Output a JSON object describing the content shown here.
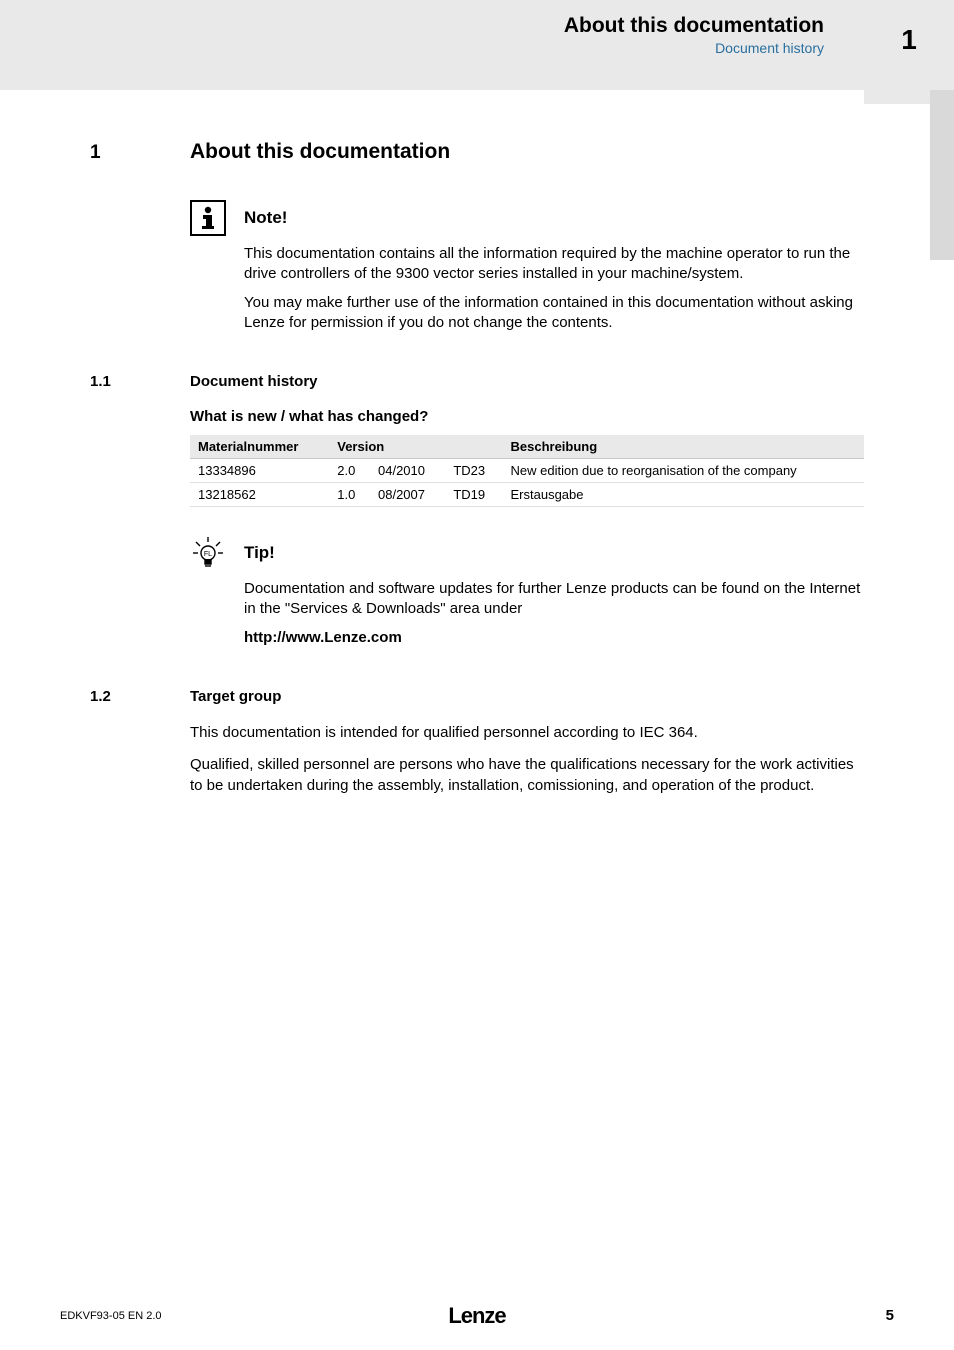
{
  "header": {
    "title": "About this documentation",
    "subtitle": "Document history",
    "chapter_number": "1"
  },
  "section": {
    "number": "1",
    "title": "About this documentation"
  },
  "note": {
    "label": "Note!",
    "para1": "This documentation contains all the information required by the machine operator to run the drive controllers of the 9300 vector series installed in your machine/system.",
    "para2": "You may make further use of the information contained in this documentation without asking Lenze for permission if you do not change the contents."
  },
  "sub1": {
    "number": "1.1",
    "title": "Document history",
    "question": "What is new / what has changed?"
  },
  "table": {
    "headers": {
      "c1": "Materialnummer",
      "c2": "Version",
      "c3": "Beschreibung"
    },
    "rows": [
      {
        "mat": "13334896",
        "v1": "2.0",
        "v2": "04/2010",
        "v3": "TD23",
        "desc": "New edition due to reorganisation of the company"
      },
      {
        "mat": "13218562",
        "v1": "1.0",
        "v2": "08/2007",
        "v3": "TD19",
        "desc": "Erstausgabe"
      }
    ]
  },
  "tip": {
    "label": "Tip!",
    "para1": "Documentation and software updates for further Lenze products can be found on the Internet in the \"Services & Downloads\" area under",
    "link": "http://www.Lenze.com"
  },
  "sub2": {
    "number": "1.2",
    "title": "Target group",
    "para1": "This documentation is intended for qualified personnel according to IEC 364.",
    "para2": "Qualified, skilled personnel are persons who have the qualifications necessary for the work activities to be undertaken during the assembly, installation, comissioning, and operation of the product."
  },
  "footer": {
    "left": "EDKVF93-05  EN  2.0",
    "brand": "Lenze",
    "page": "5"
  }
}
